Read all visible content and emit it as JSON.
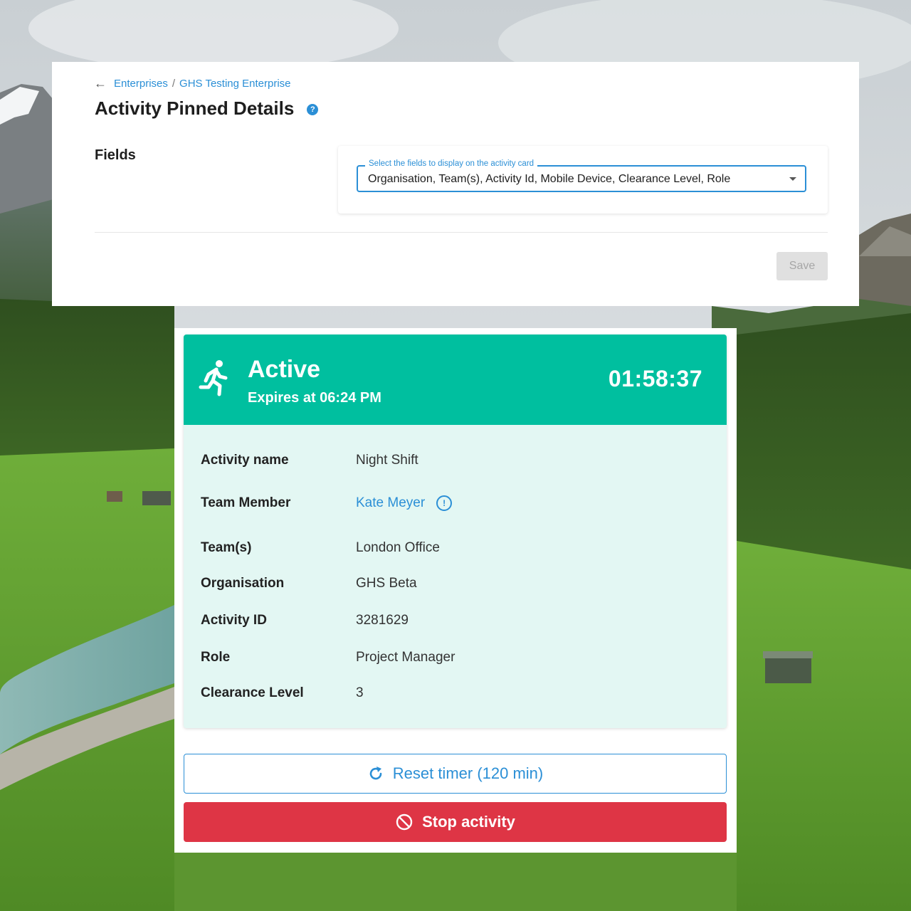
{
  "breadcrumb": {
    "back_icon": "arrow-left-icon",
    "items": [
      "Enterprises",
      "GHS Testing Enterprise"
    ],
    "separator": "/"
  },
  "page": {
    "title": "Activity Pinned Details",
    "help_icon": "question-circle-icon"
  },
  "fields": {
    "label": "Fields",
    "select_legend": "Select the fields to display on the activity card",
    "select_value": "Organisation, Team(s), Activity Id, Mobile Device, Clearance Level, Role"
  },
  "actions": {
    "save_label": "Save"
  },
  "activity": {
    "status": "Active",
    "status_icon": "running-person-icon",
    "expiry": "Expires at 06:24 PM",
    "timer": "01:58:37",
    "details": [
      {
        "label": "Activity name",
        "value": "Night Shift"
      },
      {
        "label": "Team Member",
        "value": "Kate Meyer"
      },
      {
        "label": "Team(s)",
        "value": "London Office"
      },
      {
        "label": "Organisation",
        "value": "GHS Beta"
      },
      {
        "label": "Activity ID",
        "value": "3281629"
      },
      {
        "label": "Role",
        "value": "Project Manager"
      },
      {
        "label": "Clearance Level",
        "value": "3"
      }
    ],
    "reset_label": "Reset timer (120 min)",
    "stop_label": "Stop activity"
  },
  "colors": {
    "accent": "#2b8fd6",
    "status_active": "#00bf9f",
    "card_background": "#e3f7f3",
    "danger": "#de3545"
  }
}
